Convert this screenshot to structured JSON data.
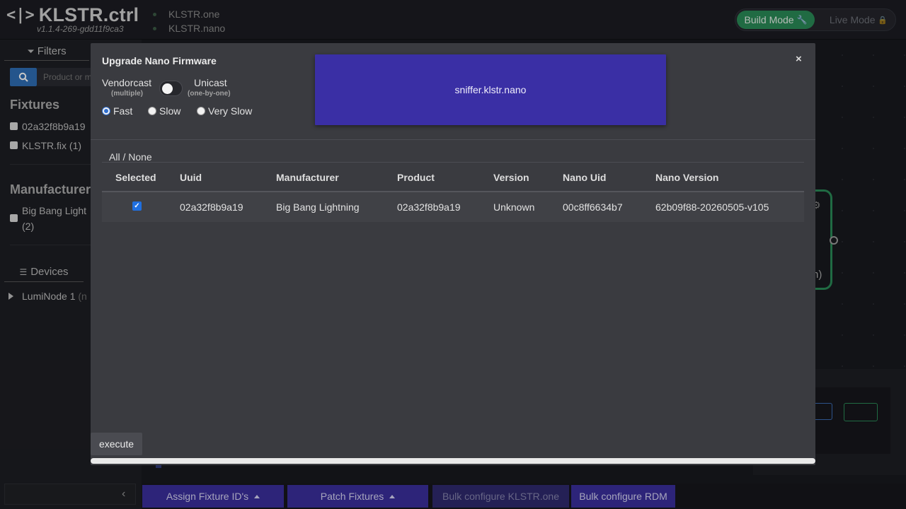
{
  "header": {
    "logo_mark": "<|>",
    "app_title": "KLSTR.ctrl",
    "version": "v1.1.4-269-gdd11f9ca3",
    "hosts": [
      "KLSTR.one",
      "KLSTR.nano"
    ],
    "build_mode_label": "Build Mode",
    "build_mode_icon": "🔧",
    "live_mode_label": "Live Mode",
    "live_mode_icon": "🔒"
  },
  "sidebar": {
    "filters_tab": "Filters",
    "filters_icon": "⏷",
    "search_placeholder": "Product or m",
    "fixtures_heading": "Fixtures",
    "fixture_items": [
      "02a32f8b9a19",
      "KLSTR.fix (1)"
    ],
    "manufacturer_heading": "Manufacturer",
    "manufacturer_item_line1": "Big Bang Light",
    "manufacturer_item_line2": "(2)",
    "devices_tab": "Devices",
    "devices_icon": "☰",
    "device_item": "LumiNode 1",
    "device_item_suffix": "(n",
    "collapse_icon": "‹"
  },
  "canvas": {
    "node_text": "n)"
  },
  "toolbar": {
    "assign_label": "Assign Fixture ID's",
    "patch_label": "Patch Fixtures",
    "bulk_one_label": "Bulk configure KLSTR.one",
    "bulk_rdm_label": "Bulk configure RDM"
  },
  "modal": {
    "title": "Upgrade Nano Firmware",
    "close": "×",
    "vendorcast_label": "Vendorcast",
    "vendorcast_sub": "(multiple)",
    "unicast_label": "Unicast",
    "unicast_sub": "(one-by-one)",
    "toggle_on": false,
    "speed_options": [
      "Fast",
      "Slow",
      "Very Slow"
    ],
    "speed_selected": "Fast",
    "device_card": "sniffer.klstr.nano",
    "all_none": "All / None",
    "columns": [
      "Selected",
      "Uuid",
      "Manufacturer",
      "Product",
      "Version",
      "Nano Uid",
      "Nano Version"
    ],
    "rows": [
      {
        "selected": true,
        "uuid": "02a32f8b9a19",
        "manufacturer": "Big Bang Lightning",
        "product": "02a32f8b9a19",
        "version": "Unknown",
        "nano_uid": "00c8ff6634b7",
        "nano_version": "62b09f88-20260505-v105"
      }
    ],
    "execute_label": "execute"
  },
  "colors": {
    "accent_purple": "#3a2fa5",
    "build_green": "#2a8a56",
    "search_blue": "#2f6eb4",
    "checkbox_blue": "#1f6fe0"
  }
}
